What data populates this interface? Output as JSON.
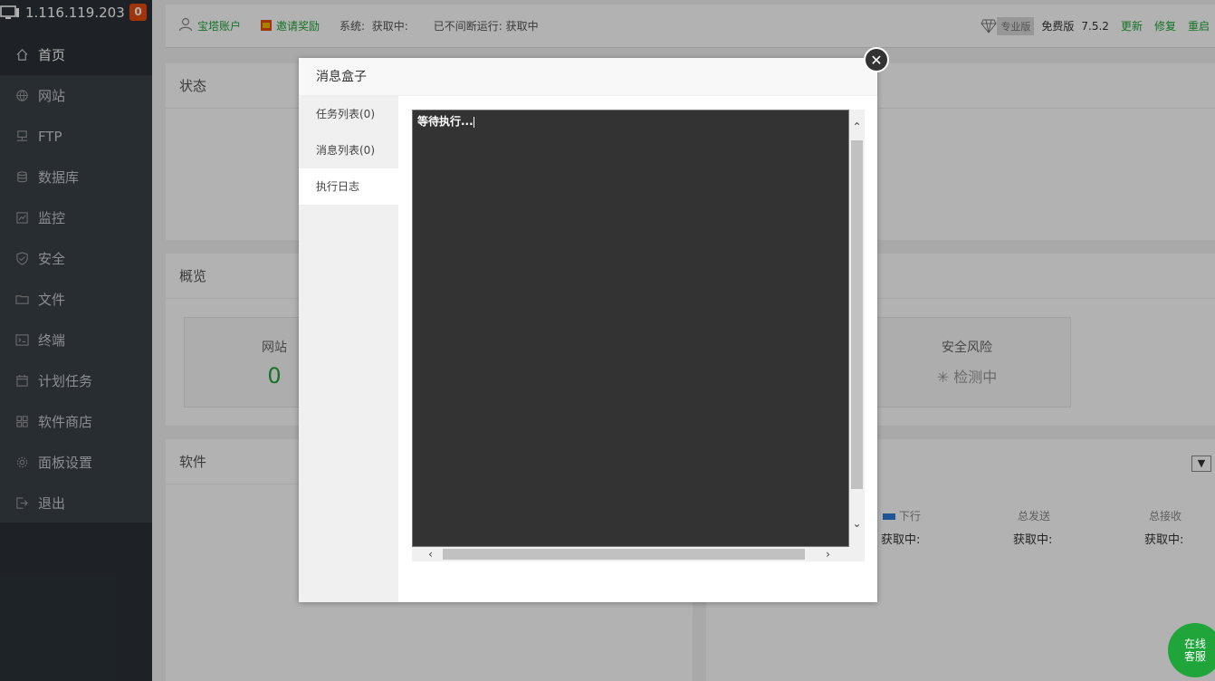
{
  "server": {
    "ip": "1.116.119.203",
    "badge": "0"
  },
  "sidebar": {
    "items": [
      {
        "label": "首页",
        "icon": "home-icon"
      },
      {
        "label": "网站",
        "icon": "globe-icon"
      },
      {
        "label": "FTP",
        "icon": "ftp-icon"
      },
      {
        "label": "数据库",
        "icon": "database-icon"
      },
      {
        "label": "监控",
        "icon": "monitor-icon"
      },
      {
        "label": "安全",
        "icon": "shield-icon"
      },
      {
        "label": "文件",
        "icon": "folder-icon"
      },
      {
        "label": "终端",
        "icon": "terminal-icon"
      },
      {
        "label": "计划任务",
        "icon": "calendar-icon"
      },
      {
        "label": "软件商店",
        "icon": "grid-icon"
      },
      {
        "label": "面板设置",
        "icon": "gear-icon"
      },
      {
        "label": "退出",
        "icon": "logout-icon"
      }
    ]
  },
  "topbar": {
    "account": "宝塔账户",
    "invite": "邀请奖励",
    "system_label": "系统:",
    "system_value": "获取中:",
    "uptime": "已不间断运行: 获取中",
    "pro": "专业版",
    "edition": "免费版",
    "version": "7.5.2",
    "update": "更新",
    "repair": "修复",
    "restart": "重启"
  },
  "panels": {
    "status": "状态",
    "overview": "概览",
    "software": "软件",
    "website_label": "网站",
    "website_count": "0",
    "security_label": "安全风险",
    "security_value": "检测中",
    "net_down": "下行",
    "total_send": "总发送",
    "total_recv": "总接收",
    "fetching": "获取中:"
  },
  "modal": {
    "title": "消息盒子",
    "tabs": [
      "任务列表(0)",
      "消息列表(0)",
      "执行日志"
    ],
    "active_tab": 2,
    "log_text": "等待执行..."
  },
  "service": {
    "line1": "在线",
    "line2": "客服"
  },
  "colors": {
    "accent": "#20a53a",
    "sidebar": "#3a4148",
    "badge": "#e74c0e"
  }
}
